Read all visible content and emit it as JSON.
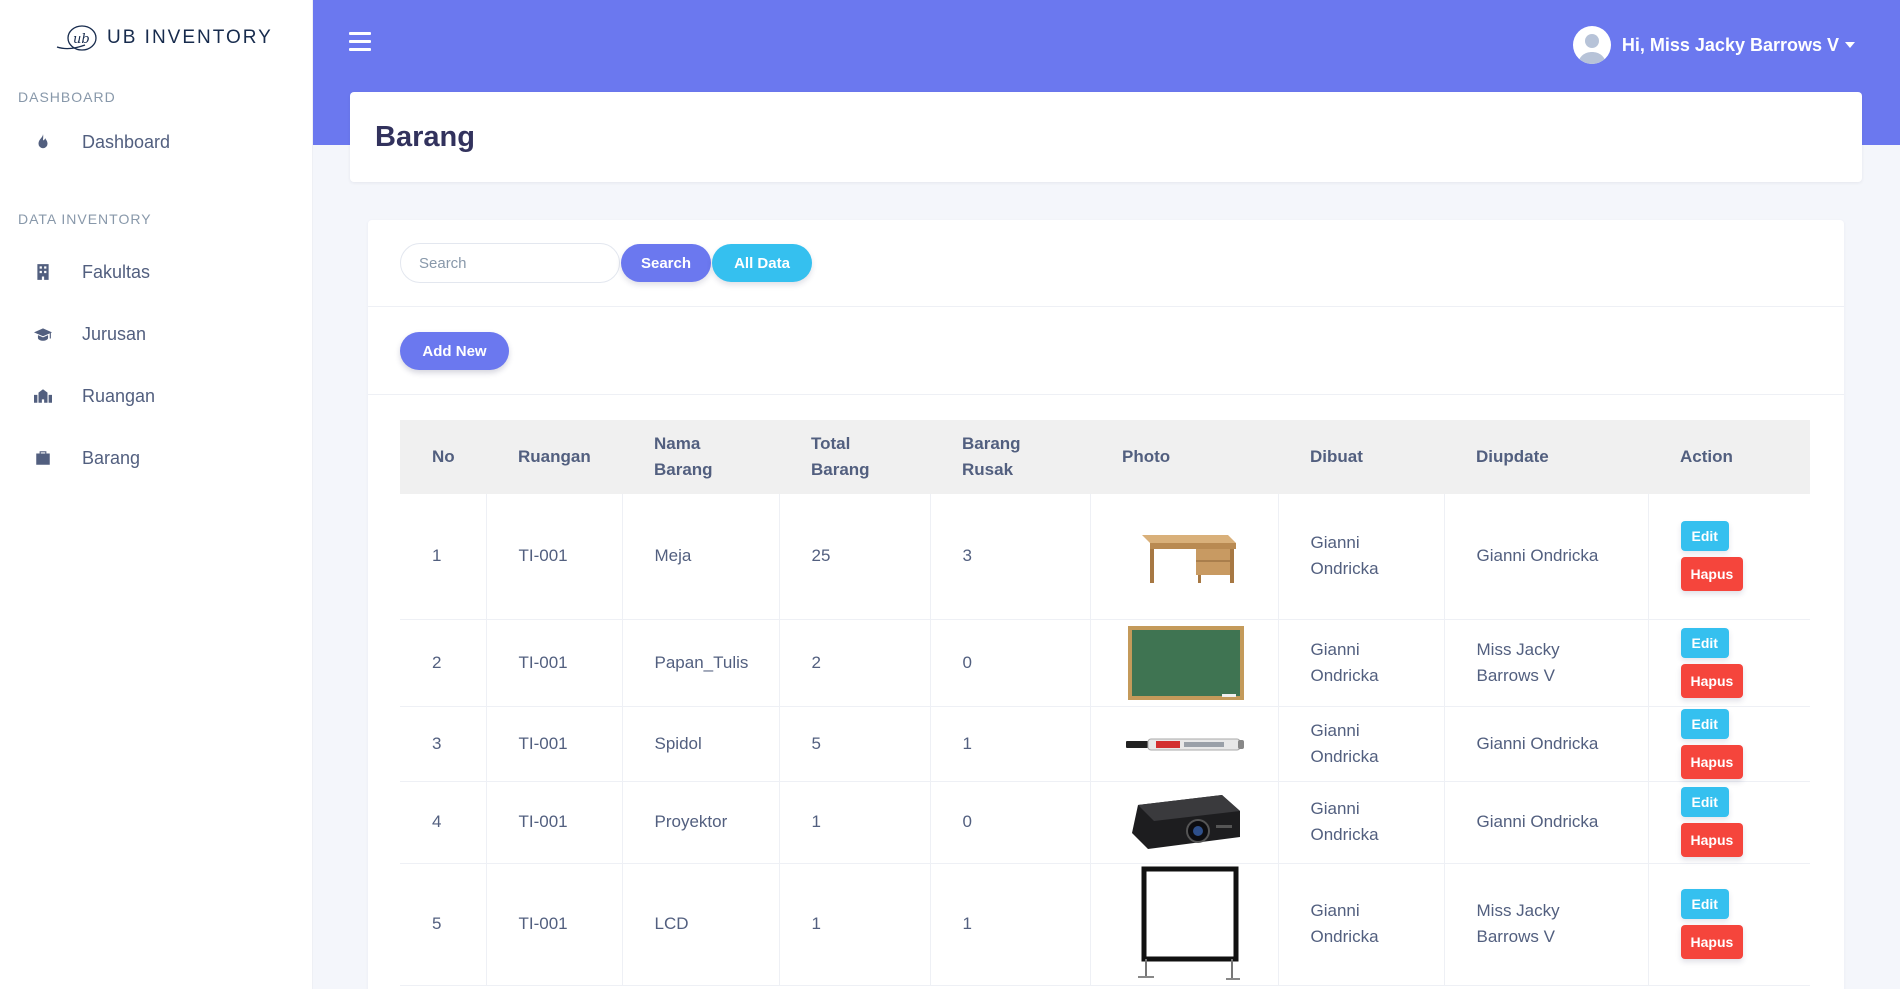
{
  "brand": {
    "name": "UB INVENTORY",
    "logo_text": "ub"
  },
  "sidebar": {
    "heading_dashboard": "DASHBOARD",
    "heading_data": "DATA INVENTORY",
    "items": [
      {
        "label": "Dashboard",
        "icon": "fire-icon"
      },
      {
        "label": "Fakultas",
        "icon": "building-icon"
      },
      {
        "label": "Jurusan",
        "icon": "graduation-cap-icon"
      },
      {
        "label": "Ruangan",
        "icon": "school-icon"
      },
      {
        "label": "Barang",
        "icon": "briefcase-icon"
      }
    ]
  },
  "header": {
    "user_greeting": "Hi, Miss Jacky Barrows V",
    "accent_color": "#6b78ef"
  },
  "page": {
    "title": "Barang"
  },
  "toolbar": {
    "search_placeholder": "Search",
    "search_label": "Search",
    "all_data_label": "All Data",
    "add_new_label": "Add New"
  },
  "table": {
    "headers": {
      "no": "No",
      "ruangan": "Ruangan",
      "nama_barang": "Nama Barang",
      "total_barang": "Total Barang",
      "barang_rusak": "Barang Rusak",
      "photo": "Photo",
      "dibuat": "Dibuat",
      "diupdate": "Diupdate",
      "action": "Action"
    },
    "edit_label": "Edit",
    "hapus_label": "Hapus",
    "rows": [
      {
        "no": "1",
        "ruangan": "TI-001",
        "nama": "Meja",
        "total": "25",
        "rusak": "3",
        "photo": "desk-photo",
        "dibuat": "Gianni Ondricka",
        "diupdate": "Gianni Ondricka"
      },
      {
        "no": "2",
        "ruangan": "TI-001",
        "nama": "Papan_Tulis",
        "total": "2",
        "rusak": "0",
        "photo": "chalkboard-photo",
        "dibuat": "Gianni Ondricka",
        "diupdate": "Miss Jacky Barrows V"
      },
      {
        "no": "3",
        "ruangan": "TI-001",
        "nama": "Spidol",
        "total": "5",
        "rusak": "1",
        "photo": "marker-photo",
        "dibuat": "Gianni Ondricka",
        "diupdate": "Gianni Ondricka"
      },
      {
        "no": "4",
        "ruangan": "TI-001",
        "nama": "Proyektor",
        "total": "1",
        "rusak": "0",
        "photo": "projector-photo",
        "dibuat": "Gianni Ondricka",
        "diupdate": "Gianni Ondricka"
      },
      {
        "no": "5",
        "ruangan": "TI-001",
        "nama": "LCD",
        "total": "1",
        "rusak": "1",
        "photo": "projection-screen-photo",
        "dibuat": "Gianni Ondricka",
        "diupdate": "Miss Jacky Barrows V"
      }
    ]
  }
}
